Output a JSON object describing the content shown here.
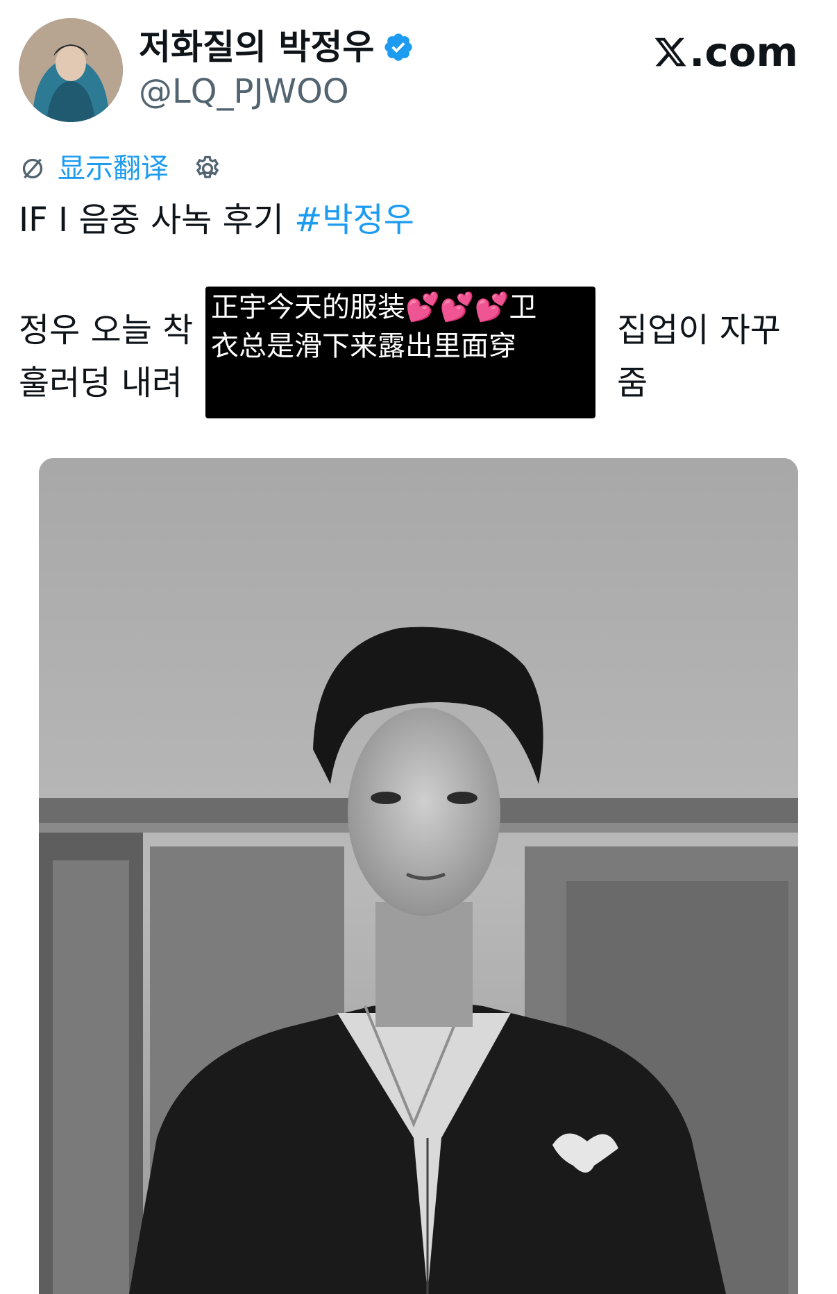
{
  "post": {
    "author": {
      "display_name": "저화질의 박정우",
      "handle": "@LQ_PJWOO",
      "verified": true,
      "avatar_icon": "avatar-photo"
    },
    "brand": {
      "logo_icon": "x-logo-icon",
      "domain_suffix": ".com"
    },
    "translate": {
      "icon": "slash-circle-icon",
      "label": "显示翻译",
      "settings_icon": "gear-icon"
    },
    "text_line1_prefix": "IF I 음중 사녹 후기 ",
    "hashtag": "#박정우",
    "body_lines": [
      "정우 오늘 착",
      "훌러덩 내려"
    ],
    "body_lines_right": [
      "집업이 자꾸",
      "줌"
    ],
    "caption_overlay": {
      "line1_text": "正宇今天的服装",
      "line1_hearts": "💕💕💕",
      "line1_tail": "卫",
      "line2_text": "衣总是滑下来露出里面穿"
    },
    "media": {
      "description_icon": "photo-black-white-portrait"
    }
  },
  "colors": {
    "link": "#1d9bf0",
    "text": "#0f1419",
    "secondary_text": "#536471",
    "verified": "#1d9bf0",
    "heart": "#ff4fa3"
  }
}
